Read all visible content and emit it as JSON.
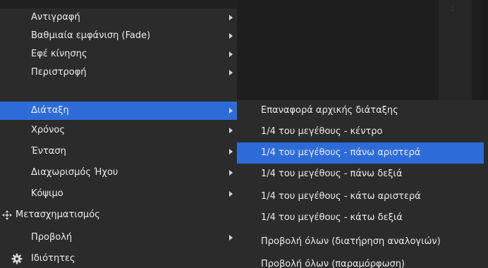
{
  "menu": {
    "items": [
      {
        "label": "Αντιγραφή",
        "submenu": true
      },
      {
        "label": "Βαθμιαία εμφάνιση (Fade)",
        "submenu": true
      },
      {
        "label": "Εφέ κίνησης",
        "submenu": true
      },
      {
        "label": "Περιστροφή",
        "submenu": true
      },
      {
        "label": "Διάταξη",
        "submenu": true
      },
      {
        "label": "Χρόνος",
        "submenu": true
      },
      {
        "label": "Ένταση",
        "submenu": true
      },
      {
        "label": "Διαχωρισμός Ήχου",
        "submenu": true
      },
      {
        "label": "Κόψιμο",
        "submenu": true
      },
      {
        "label": "Μετασχηματισμός",
        "submenu": false,
        "icon": "move-arrows-icon"
      },
      {
        "label": "Προβολή",
        "submenu": true
      },
      {
        "label": "Ιδιότητες",
        "submenu": false,
        "icon": "gear-icon"
      }
    ],
    "active_label": "Διάταξη"
  },
  "submenu": {
    "items": [
      {
        "label": "Επαναφορά αρχικής διάταξης"
      },
      {
        "label": "1/4 του μεγέθους - κέντρο"
      },
      {
        "label": "1/4 του μεγέθους - πάνω αριστερά"
      },
      {
        "label": "1/4 του μεγέθους - πάνω δεξιά"
      },
      {
        "label": "1/4 του μεγέθους - κάτω αριστερά"
      },
      {
        "label": "1/4 του μεγέθους - κάτω δεξιά"
      },
      {
        "label": "Προβολή όλων (διατήρηση αναλογιών)"
      },
      {
        "label": "Προβολή όλων (παραμόρφωση)"
      }
    ],
    "active_label": "1/4 του μεγέθους - πάνω αριστερά"
  },
  "colors": {
    "menu_bg": "#2b2b2b",
    "highlight": "#2d6cd8",
    "text": "#ececec",
    "background": "#202020"
  }
}
